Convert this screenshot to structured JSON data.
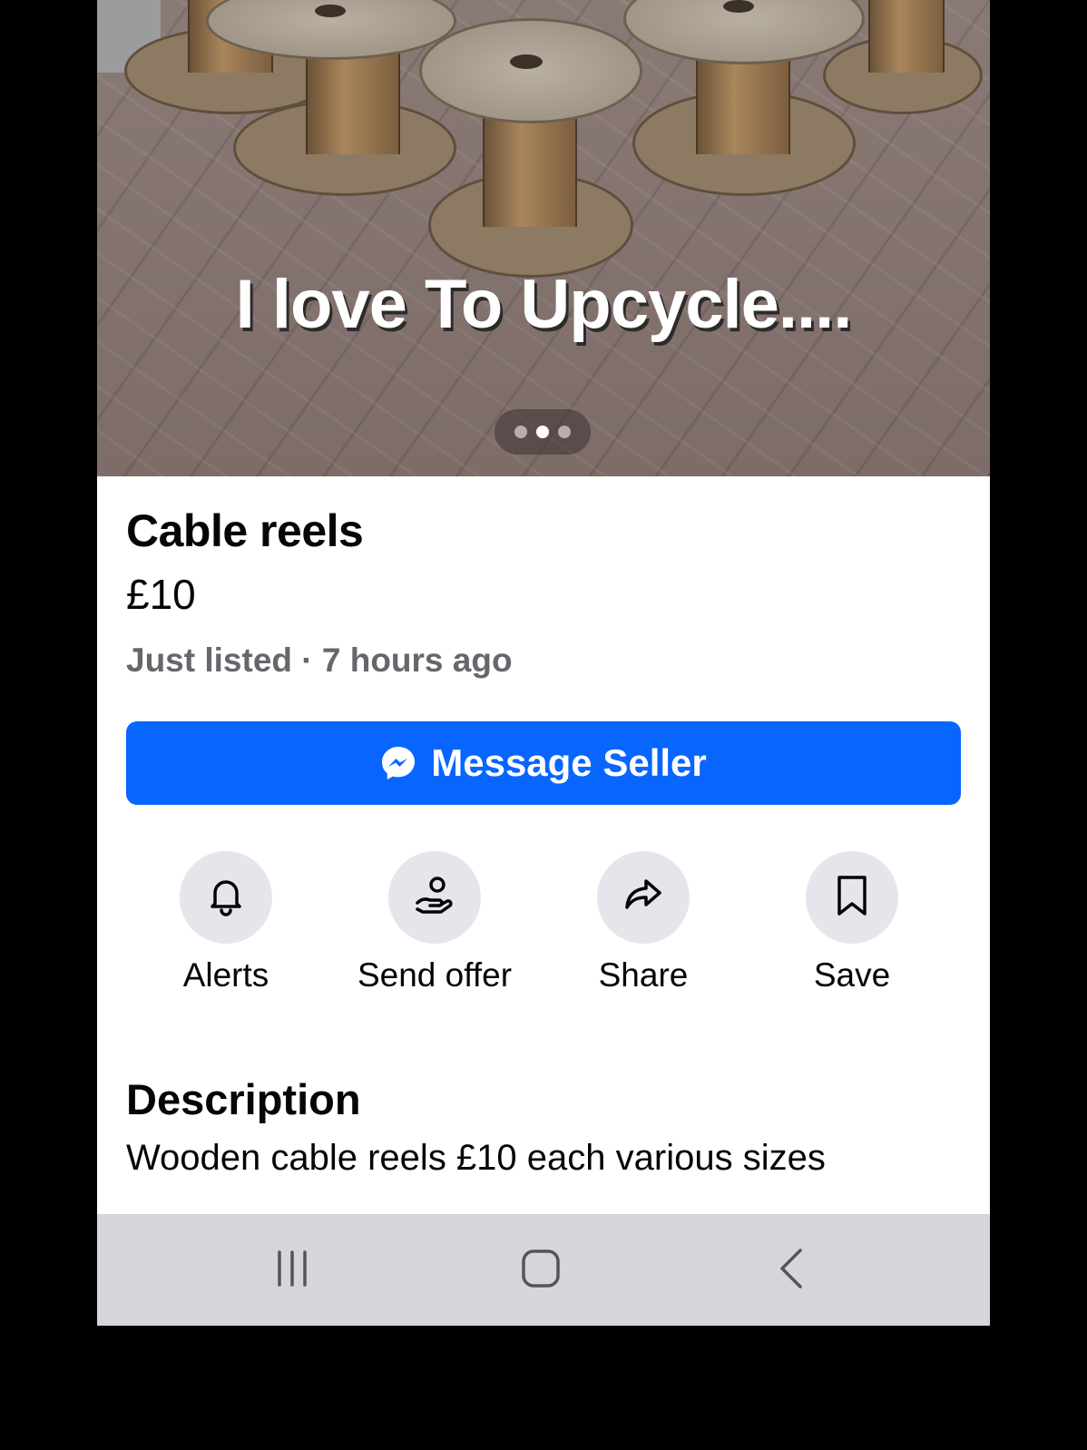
{
  "photo": {
    "overlay_text": "I love To Upcycle....",
    "carousel": {
      "count": 3,
      "active_index": 1
    }
  },
  "listing": {
    "title": "Cable reels",
    "price": "£10",
    "meta": "Just listed · 7 hours ago"
  },
  "primary_action": {
    "label": "Message Seller",
    "icon": "messenger-icon",
    "color": "#0866ff"
  },
  "actions": [
    {
      "label": "Alerts",
      "icon": "bell-icon"
    },
    {
      "label": "Send offer",
      "icon": "offer-hand-icon"
    },
    {
      "label": "Share",
      "icon": "share-arrow-icon"
    },
    {
      "label": "Save",
      "icon": "bookmark-icon"
    }
  ],
  "description": {
    "heading": "Description",
    "text": "Wooden cable reels £10 each various sizes"
  },
  "system_nav": {
    "buttons": [
      {
        "name": "recent-apps",
        "icon": "recent-apps-icon"
      },
      {
        "name": "home",
        "icon": "home-icon"
      },
      {
        "name": "back",
        "icon": "back-chevron-icon"
      }
    ]
  }
}
